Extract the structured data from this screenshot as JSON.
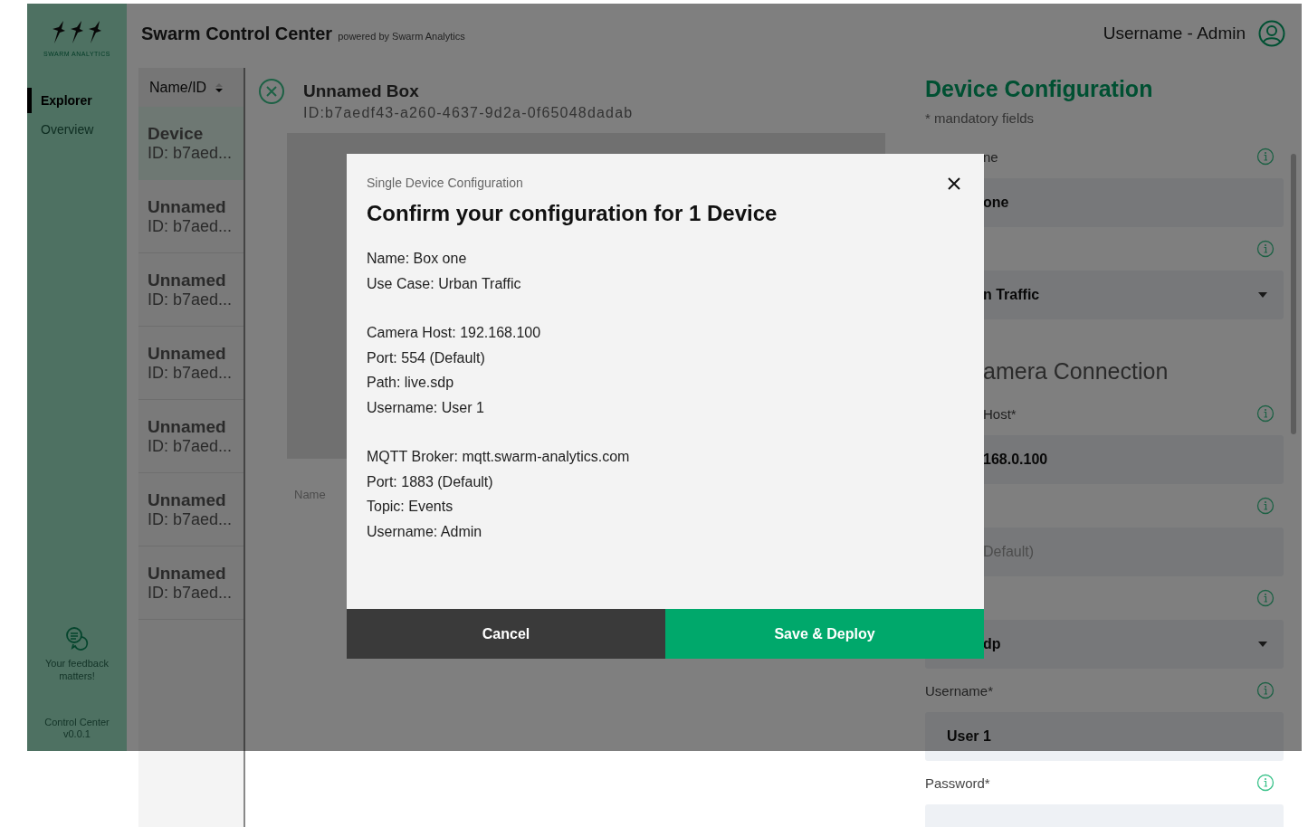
{
  "sidebar": {
    "logo_text": "SWARM ANALYTICS",
    "items": [
      {
        "label": "Explorer",
        "selected": true
      },
      {
        "label": "Overview",
        "selected": false
      }
    ],
    "feedback": "Your feedback matters!",
    "app_name": "Control Center",
    "version": "v0.0.1"
  },
  "header": {
    "title": "Swarm Control Center",
    "subtitle": "powered by Swarm Analytics",
    "user": "Username - Admin"
  },
  "device_list": {
    "column": "Name/ID",
    "items": [
      {
        "name": "Device",
        "id": "ID: b7aed...",
        "selected": true
      },
      {
        "name": "Unnamed",
        "id": "ID: b7aed...",
        "selected": false
      },
      {
        "name": "Unnamed",
        "id": "ID: b7aed...",
        "selected": false
      },
      {
        "name": "Unnamed",
        "id": "ID: b7aed...",
        "selected": false
      },
      {
        "name": "Unnamed",
        "id": "ID: b7aed...",
        "selected": false
      },
      {
        "name": "Unnamed",
        "id": "ID: b7aed...",
        "selected": false
      },
      {
        "name": "Unnamed",
        "id": "ID: b7aed...",
        "selected": false
      }
    ]
  },
  "device": {
    "title": "Unnamed Box",
    "id": "ID:b7aedf43-a260-4637-9d2a-0f65048dadab",
    "field_label": "Name"
  },
  "form": {
    "title": "Device Configuration",
    "note": "* mandatory fields",
    "rows": [
      {
        "kind": "label",
        "text": "ne",
        "inset": true
      },
      {
        "kind": "input",
        "value": "one",
        "inset": true
      },
      {
        "kind": "label"
      },
      {
        "kind": "select",
        "value": "n Traffic",
        "inset": true
      },
      {
        "kind": "section",
        "text": "amera Connection",
        "inset": true
      },
      {
        "kind": "label",
        "text": "Host*",
        "inset": true
      },
      {
        "kind": "input",
        "value": "168.0.100",
        "inset": true
      },
      {
        "kind": "label"
      },
      {
        "kind": "input",
        "placeholder": "Default)",
        "inset": true
      },
      {
        "kind": "label"
      },
      {
        "kind": "select",
        "value": "dp",
        "inset": true
      },
      {
        "kind": "label",
        "text": "Username*",
        "inset": false
      },
      {
        "kind": "input",
        "value": "User 1",
        "inset": false
      },
      {
        "kind": "label",
        "text": "Password*",
        "inset": false
      },
      {
        "kind": "input"
      }
    ]
  },
  "modal": {
    "subtitle": "Single Device Configuration",
    "title": "Confirm your configuration for 1 Device",
    "groups": [
      [
        "Name: Box one",
        "Use Case: Urban Traffic"
      ],
      [
        "Camera Host: 192.168.100",
        "Port: 554 (Default)",
        "Path: live.sdp",
        "Username: User 1"
      ],
      [
        "MQTT Broker: mqtt.swarm-analytics.com",
        "Port: 1883 (Default)",
        "Topic: Events",
        "Username: Admin"
      ]
    ],
    "buttons": [
      {
        "label": "Cancel",
        "kind": "secondary"
      },
      {
        "label": "Save & Deploy",
        "kind": "primary"
      }
    ]
  }
}
